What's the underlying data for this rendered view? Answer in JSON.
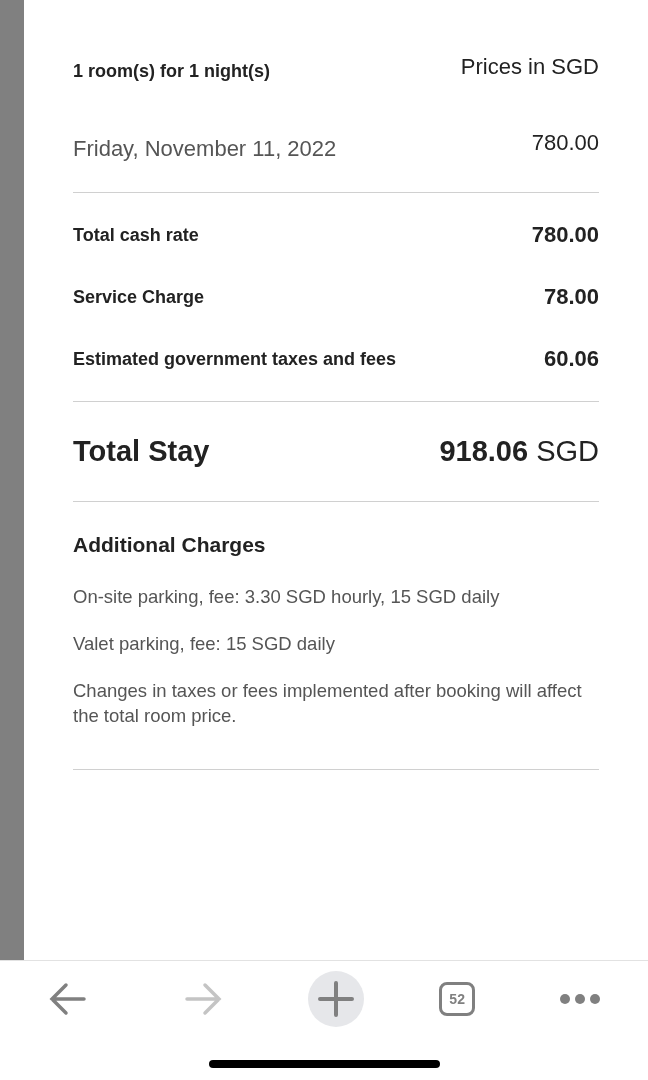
{
  "summary": {
    "rooms_nights": "1 room(s) for 1 night(s)",
    "currency_note": "Prices in SGD"
  },
  "nights": [
    {
      "date": "Friday, November 11, 2022",
      "amount": "780.00"
    }
  ],
  "charges": [
    {
      "label": "Total cash rate",
      "amount": "780.00"
    },
    {
      "label": "Service Charge",
      "amount": "78.00"
    },
    {
      "label": "Estimated government taxes and fees",
      "amount": "60.06"
    }
  ],
  "total": {
    "label": "Total Stay",
    "amount": "918.06",
    "currency": "SGD"
  },
  "additional": {
    "title": "Additional Charges",
    "lines": [
      "On-site parking, fee: 3.30 SGD hourly, 15 SGD daily",
      "Valet parking, fee: 15 SGD daily",
      "Changes in taxes or fees implemented after booking will affect the total room price."
    ]
  },
  "toolbar": {
    "back": {
      "disabled": false
    },
    "forward": {
      "disabled": true
    },
    "tab_count": "52"
  }
}
